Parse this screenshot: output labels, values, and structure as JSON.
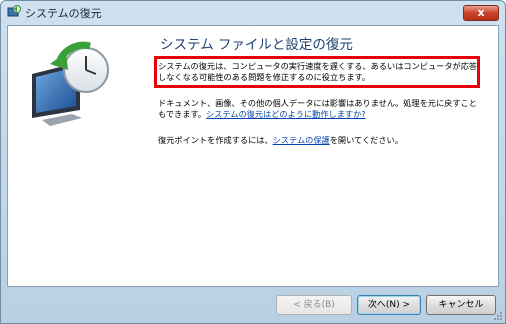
{
  "window": {
    "title": "システムの復元",
    "close_label": "x"
  },
  "main": {
    "heading": "システム ファイルと設定の復元",
    "paragraph1": "システムの復元は、コンピュータの実行速度を遅くする、あるいはコンピュータが応答しなくなる可能性のある問題を修正するのに役立ちます。",
    "paragraph2_text": "ドキュメント、画像、その他の個人データには影響はありません。処理を元に戻すこともできます。",
    "paragraph2_link": "システムの復元はどのように動作しますか?",
    "paragraph3_text": "復元ポイントを作成するには、",
    "paragraph3_link": "システムの保護",
    "paragraph3_suffix": "を開いてください。"
  },
  "footer": {
    "back_label": "< 戻る(B)",
    "next_label": "次へ(N) >",
    "cancel_label": "キャンセル"
  },
  "colors": {
    "highlight": "#e8000b",
    "heading": "#1e3f73",
    "link": "#0645ad"
  }
}
